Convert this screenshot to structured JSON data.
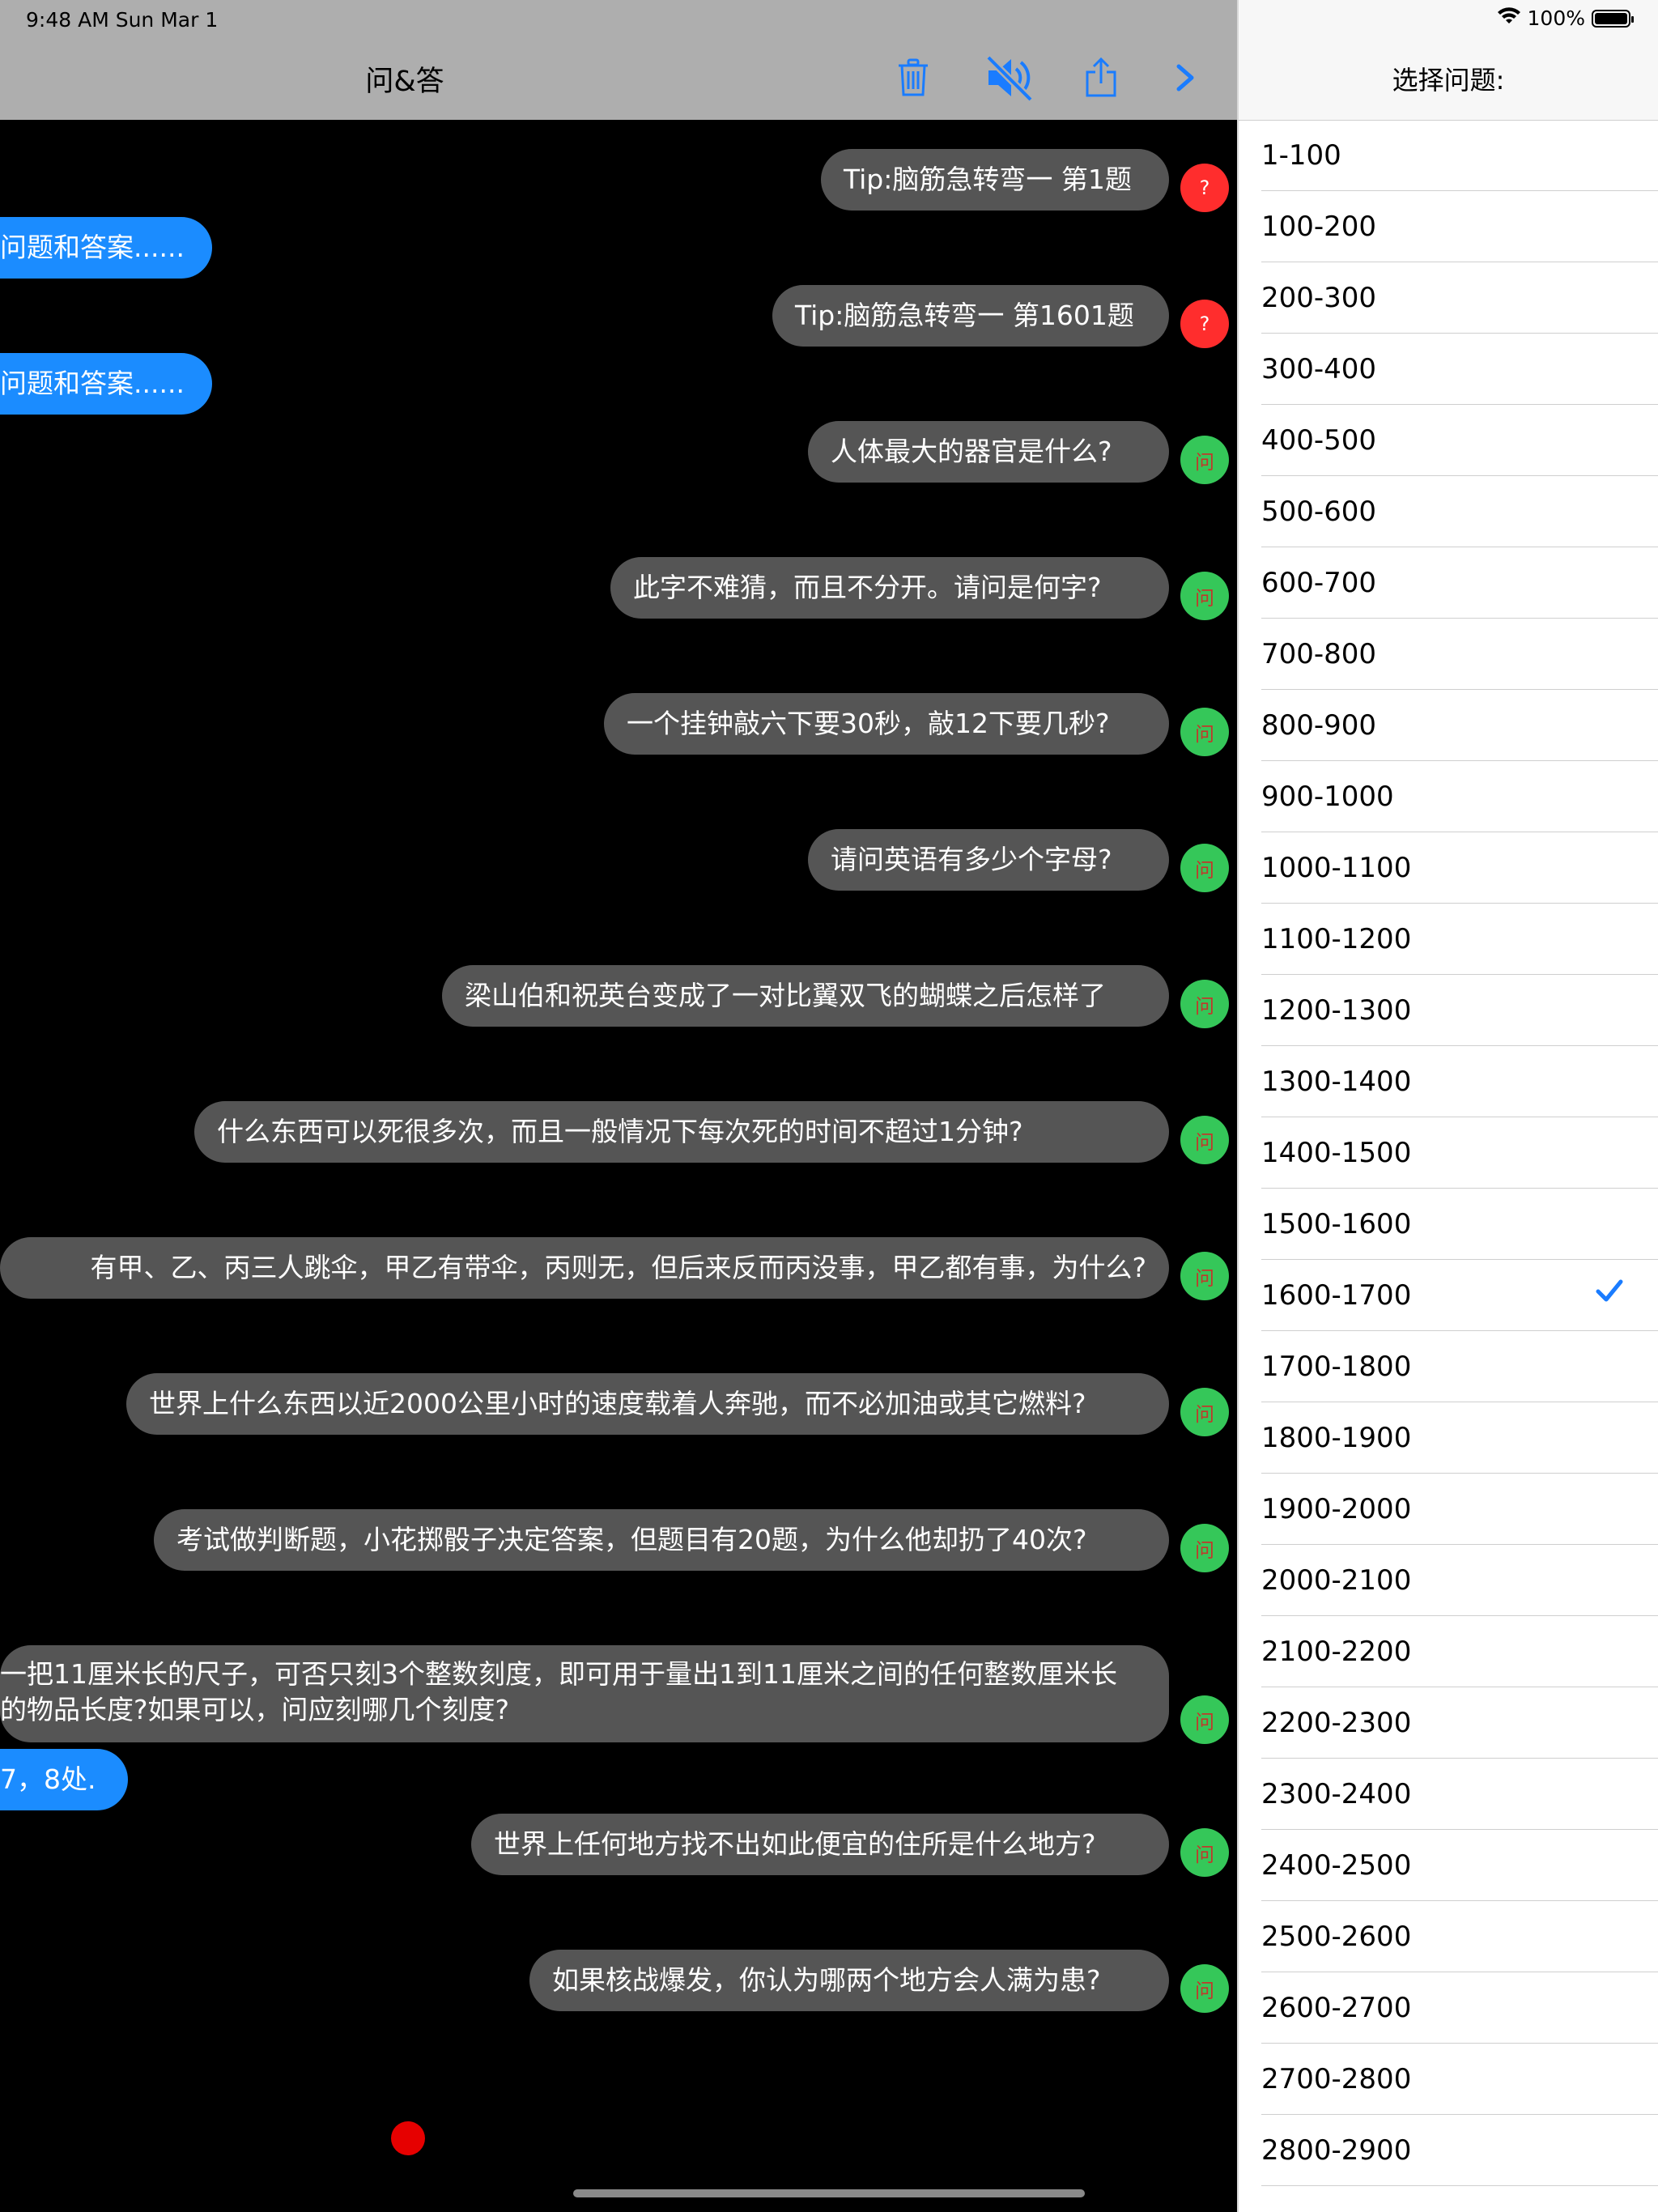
{
  "status_bar": {
    "time_date": "9:48 AM  Sun Mar 1",
    "battery": "100%",
    "battery_level": 1.0
  },
  "nav_bar": {
    "title": "问&答",
    "icons": [
      "trash-icon",
      "speaker-muted-icon",
      "share-icon",
      "chevron-right-icon"
    ]
  },
  "messages": [
    {
      "type": "question",
      "text": "Tip:脑筋急转弯一  第1题",
      "avatar": "?"
    },
    {
      "type": "answer",
      "text": "问题和答案......"
    },
    {
      "type": "question",
      "text": "Tip:脑筋急转弯一  第1601题",
      "avatar": "?"
    },
    {
      "type": "answer",
      "text": "问题和答案......"
    },
    {
      "type": "question",
      "text": "人体最大的器官是什么?",
      "avatar": "问"
    },
    {
      "type": "question",
      "text": "此字不难猜，而且不分开。请问是何字?",
      "avatar": "问"
    },
    {
      "type": "question",
      "text": "一个挂钟敲六下要30秒，敲12下要几秒?",
      "avatar": "问"
    },
    {
      "type": "question",
      "text": "请问英语有多少个字母?",
      "avatar": "问"
    },
    {
      "type": "question",
      "text": "梁山伯和祝英台变成了一对比翼双飞的蝴蝶之后怎样了",
      "avatar": "问"
    },
    {
      "type": "question",
      "text": "什么东西可以死很多次，而且一般情况下每次死的时间不超过1分钟?",
      "avatar": "问"
    },
    {
      "type": "question",
      "text": "有甲、乙、丙三人跳伞，甲乙有带伞，丙则无，但后来反而丙没事，甲乙都有事，为什么?",
      "avatar": "问"
    },
    {
      "type": "question",
      "text": "世界上什么东西以近2000公里小时的速度载着人奔驰，而不必加油或其它燃料?",
      "avatar": "问"
    },
    {
      "type": "question",
      "text": "考试做判断题，小花掷骰子决定答案，但题目有20题，为什么他却扔了40次?",
      "avatar": "问"
    },
    {
      "type": "question",
      "text": "一把11厘米长的尺子，可否只刻3个整数刻度，即可用于量出1到11厘米之间的任何整数厘米长",
      "text2": "的物品长度?如果可以，问应刻哪几个刻度?",
      "avatar": "问"
    },
    {
      "type": "answer",
      "text": "7，8处."
    },
    {
      "type": "question",
      "text": "世界上任何地方找不出如此便宜的住所是什么地方?",
      "avatar": "问"
    },
    {
      "type": "question",
      "text": "如果核战爆发，你认为哪两个地方会人满为患?",
      "avatar": "问"
    }
  ],
  "picker": {
    "title": "选择问题:",
    "selected": "1600-1700",
    "items": [
      "1-100",
      "100-200",
      "200-300",
      "300-400",
      "400-500",
      "500-600",
      "600-700",
      "700-800",
      "800-900",
      "900-1000",
      "1000-1100",
      "1100-1200",
      "1200-1300",
      "1300-1400",
      "1400-1500",
      "1500-1600",
      "1600-1700",
      "1700-1800",
      "1800-1900",
      "1900-2000",
      "2000-2100",
      "2100-2200",
      "2200-2300",
      "2300-2400",
      "2400-2500",
      "2500-2600",
      "2600-2700",
      "2700-2800",
      "2800-2900"
    ]
  }
}
